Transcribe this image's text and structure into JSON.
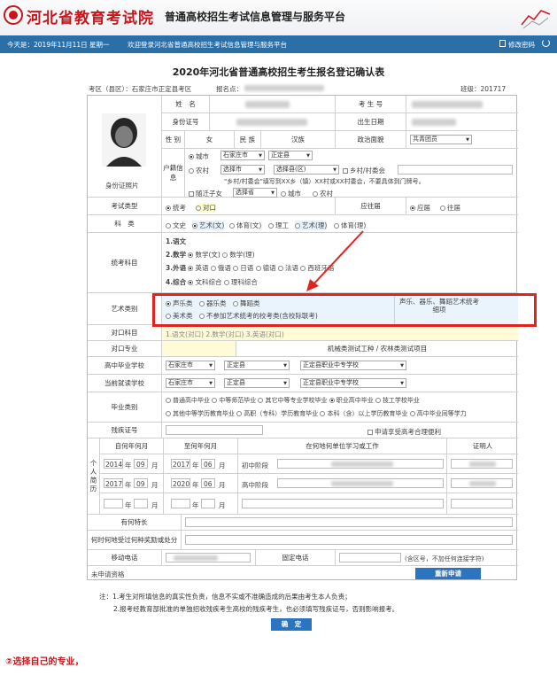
{
  "header": {
    "site_name": "河北省教育考试院",
    "platform": "普通高校招生考试信息管理与服务平台"
  },
  "topbar": {
    "date": "今天是：2019年11月11日 星期一",
    "welcome": "欢迎登录河北省普通高校招生考试信息管理与服务平台",
    "change_password": "修改密码"
  },
  "form": {
    "title": "2020年河北省普通高校招生考生报名登记确认表",
    "area_label": "考区（县区）：石家庄市正定县考区",
    "signup_no_label": "报名点：",
    "class_label": "班级：201717",
    "photo_label": "身份证照片",
    "name_label": "姓　名",
    "exam_no_label": "考 生 号",
    "id_label": "身份证号",
    "birth_label": "出生日期",
    "gender_label": "性 别",
    "gender_value": "女",
    "ethnic_label": "民 族",
    "ethnic_value": "汉族",
    "political_label": "政治面貌",
    "political_value": "共青团员",
    "hukou_label": "户籍信息",
    "hukou_city": "城市",
    "hukou_city_sel1": "石家庄市",
    "hukou_city_sel2": "正定县",
    "hukou_rural": "农村",
    "hukou_rural_sel1": "选择市",
    "hukou_rural_sel2": "选择县(区)",
    "hukou_rural_village": "乡村/村委会",
    "hukou_hint": "\"乡村/村委会\"填写到XX乡（镇）XX村或XX村委会，不要具体到门牌号。",
    "hukou_follow": "随迁子女",
    "hukou_follow_sel": "选择省",
    "hukou_follow_city": "城市",
    "hukou_follow_rural": "农村",
    "exam_type_label": "考试类型",
    "exam_type_opt1": "统考",
    "exam_type_opt2": "对口",
    "fresh_label": "应往届",
    "fresh_opt1": "应届",
    "fresh_opt2": "往届",
    "subject_label": "科　类",
    "subj_opts": [
      "文史",
      "艺术(文)",
      "体育(文)",
      "理工",
      "艺术(理)",
      "体育(理)"
    ],
    "exam_subjects_label": "统考科目",
    "exam_subj_1": "1.语文",
    "exam_subj_2": "2.数学",
    "exam_subj_2a": "数学(文)",
    "exam_subj_2b": "数学(理)",
    "exam_subj_3": "3.外语",
    "exam_subj_3_opts": [
      "英语",
      "俄语",
      "日语",
      "德语",
      "法语",
      "西班牙语"
    ],
    "exam_subj_4": "4.综合",
    "exam_subj_4a": "文科综合",
    "exam_subj_4b": "理科综合",
    "art_label": "艺术类别",
    "art_opts_row1": [
      "声乐类",
      "器乐类",
      "舞蹈类"
    ],
    "art_opt_fine": "美术类",
    "art_opt_none": "不参加艺术统考的校考类(含校际联考)",
    "art_note": "声乐、器乐、舞蹈艺术统考细项",
    "vocational_label": "对口科目",
    "vocational_value": "1.语文(对口) 2.数学(对口) 3.英语(对口)",
    "vocational_major_label": "对口专业",
    "vocational_major_value": "机械类测试工种 / 农林类测试项目",
    "hs_grad_label": "高中毕业学校",
    "hs_grad_city": "石家庄市",
    "hs_grad_county": "正定县",
    "hs_grad_school": "正定县职业中专学校",
    "hs_cur_label": "当前就读学校",
    "hs_cur_city": "石家庄市",
    "hs_cur_county": "正定县",
    "hs_cur_school": "正定县职业中专学校",
    "grad_type_label": "毕业类别",
    "grad_types_row1": [
      "普通高中毕业",
      "中等师范毕业",
      "其它中等专业学校毕业",
      "职业高中毕业",
      "技工学校毕业"
    ],
    "grad_types_row2": [
      "其他中等学历教育毕业",
      "高职（专科）学历教育毕业",
      "本科（含）以上学历教育毕业",
      "高中毕业同等学力"
    ],
    "disability_label": "残疾证号",
    "disability_apply": "申请享受高考合理便利",
    "resume_label": "个人简历",
    "start_col": "自何年何月",
    "end_col": "至何年何月",
    "place_col": "在何地何单位学习或工作",
    "witness_col": "证明人",
    "year_label": "年",
    "month_label": "月",
    "resume_rows": [
      {
        "sy": "2014",
        "sm": "09",
        "ey": "2017",
        "em": "06",
        "place": "初中阶段"
      },
      {
        "sy": "2017",
        "sm": "09",
        "ey": "2020",
        "em": "06",
        "place": "高中阶段"
      },
      {
        "sy": "",
        "sm": "",
        "ey": "",
        "em": "",
        "place": ""
      }
    ],
    "specialty_label": "有何特长",
    "award_label": "何时何地受过何种奖励或处分",
    "mobile_label": "移动电话",
    "phone_label": "固定电话",
    "phone_hint": "(含区号，不加任何连接字符)",
    "unsubmitted_label": "未申请资格",
    "reapply_button": "重新申请",
    "note1": "注：1.考生对所填信息的真实性负责，信息不实或不准确造成的后果由考生本人负责；",
    "note2": "2.报考经教育部批准的单独招收残疾考生高校的残疾考生，也必须填写残疾证号，否则影响报考。",
    "confirm_button": "确　定"
  },
  "caption": "②选择自己的专业，",
  "colors": {
    "accent": "#2b74c0",
    "brand_red": "#c8161d",
    "highlight_box": "#e0241d"
  }
}
